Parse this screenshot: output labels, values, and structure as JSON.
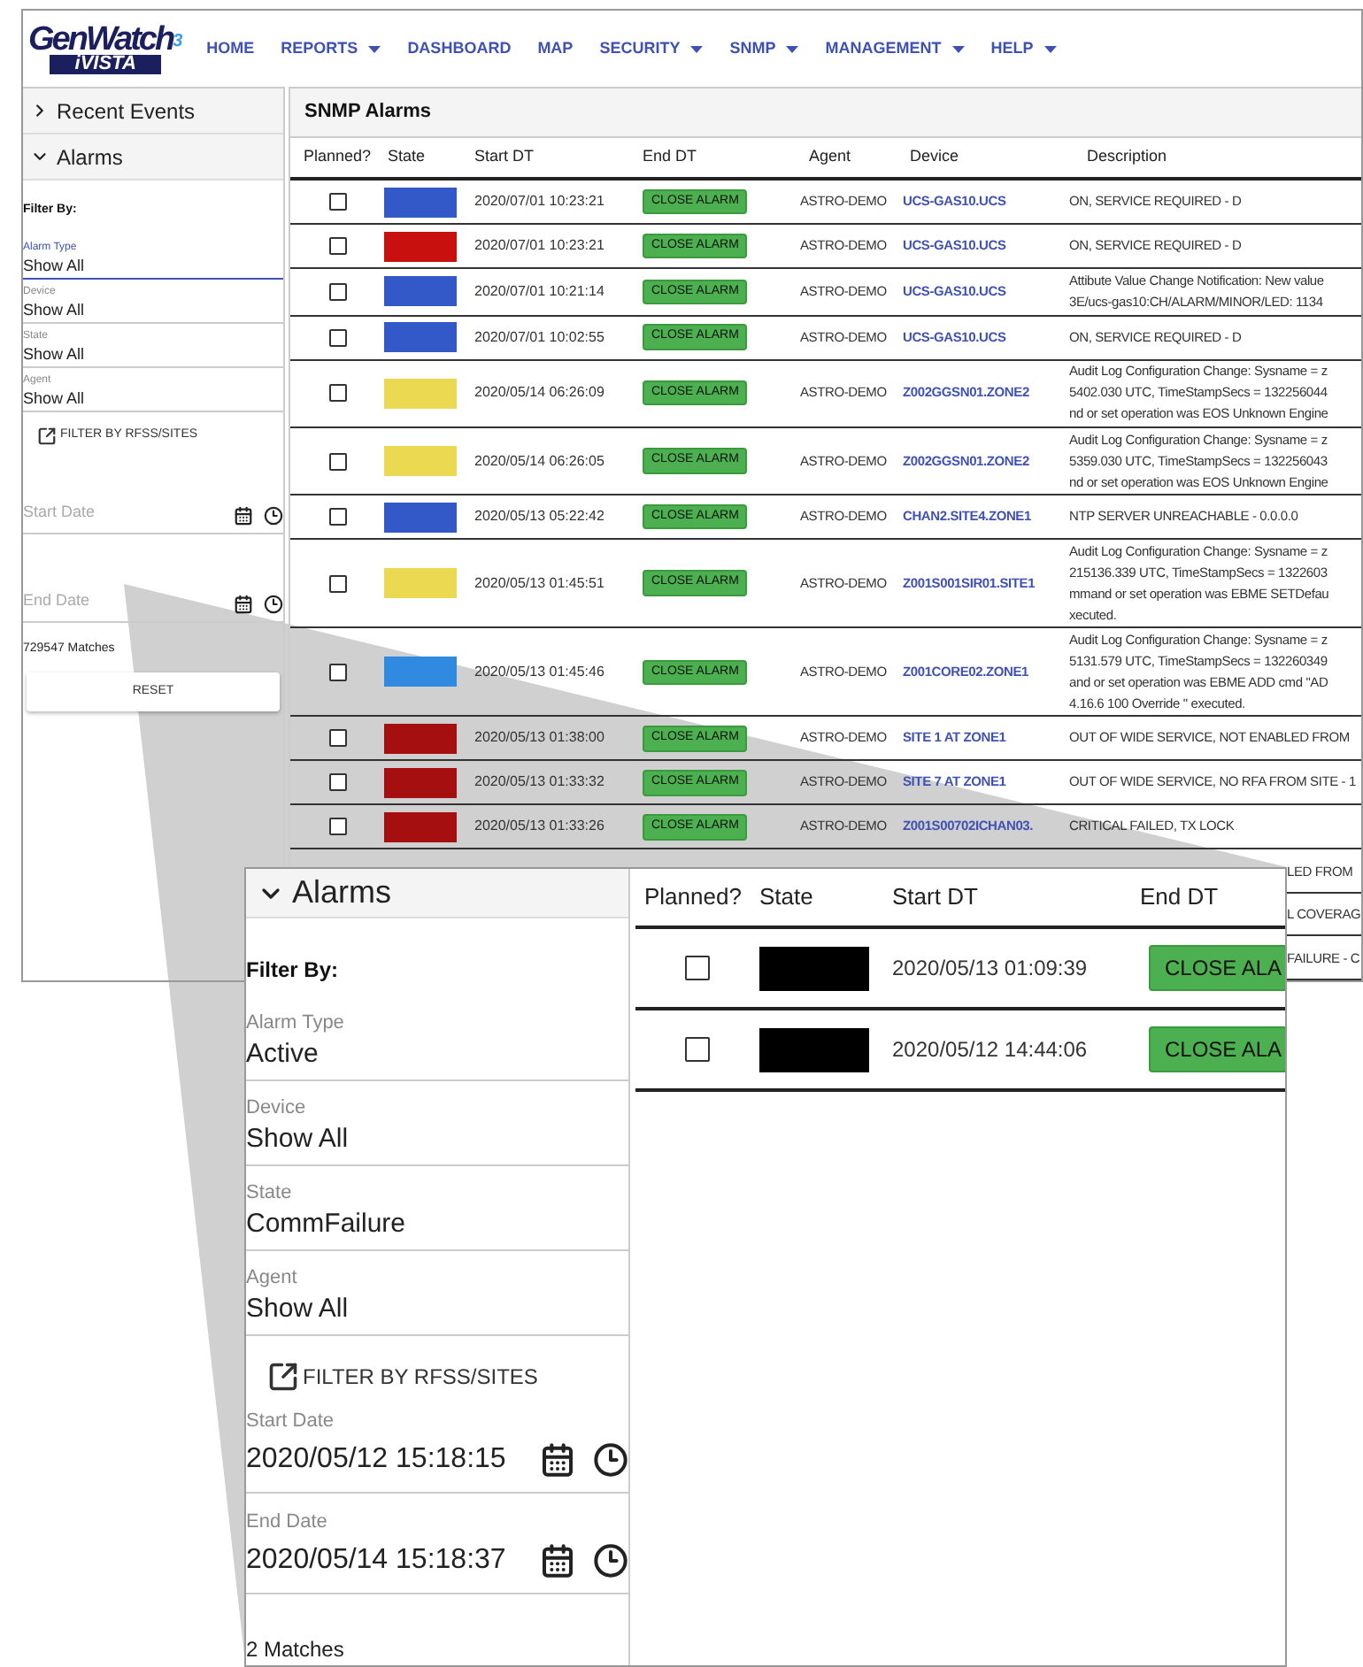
{
  "nav": {
    "logo": {
      "name": "GenWatch",
      "version": "3",
      "edition": "iVISTA"
    },
    "items": [
      {
        "label": "HOME",
        "dropdown": false
      },
      {
        "label": "REPORTS",
        "dropdown": true
      },
      {
        "label": "DASHBOARD",
        "dropdown": false
      },
      {
        "label": "MAP",
        "dropdown": false
      },
      {
        "label": "SECURITY",
        "dropdown": true
      },
      {
        "label": "SNMP",
        "dropdown": true
      },
      {
        "label": "MANAGEMENT",
        "dropdown": true
      },
      {
        "label": "HELP",
        "dropdown": true
      }
    ]
  },
  "sidebar": {
    "sections": [
      {
        "title": "Recent Events",
        "expanded": false
      },
      {
        "title": "Alarms",
        "expanded": true
      }
    ],
    "filter_heading": "Filter By:",
    "fields": [
      {
        "label": "Alarm Type",
        "value": "Show All",
        "focused": true
      },
      {
        "label": "Device",
        "value": "Show All",
        "focused": false
      },
      {
        "label": "State",
        "value": "Show All",
        "focused": false
      },
      {
        "label": "Agent",
        "value": "Show All",
        "focused": false
      }
    ],
    "filter_link": "FILTER BY RFSS/SITES",
    "dates": [
      {
        "placeholder": "Start Date"
      },
      {
        "placeholder": "End Date"
      }
    ],
    "matches": "729547 Matches",
    "reset": "RESET"
  },
  "table": {
    "title": "SNMP Alarms",
    "columns": [
      "Planned?",
      "State",
      "Start DT",
      "End DT",
      "Agent",
      "Device",
      "Description"
    ],
    "rows": [
      {
        "planned": false,
        "color": "#3358c8",
        "start": "2020/07/01 10:23:21",
        "action": "CLOSE ALARM",
        "agent": "ASTRO-DEMO",
        "device": "UCS-GAS10.UCS",
        "description": [
          "ON, SERVICE REQUIRED - D"
        ]
      },
      {
        "planned": false,
        "color": "#c8100f",
        "start": "2020/07/01 10:23:21",
        "action": "CLOSE ALARM",
        "agent": "ASTRO-DEMO",
        "device": "UCS-GAS10.UCS",
        "description": [
          "ON, SERVICE REQUIRED - D"
        ]
      },
      {
        "planned": false,
        "color": "#3358c8",
        "start": "2020/07/01 10:21:14",
        "action": "CLOSE ALARM",
        "agent": "ASTRO-DEMO",
        "device": "UCS-GAS10.UCS",
        "description": [
          "Attibute Value Change Notification: New value",
          "3E/ucs-gas10:CH/ALARM/MINOR/LED: 1134"
        ]
      },
      {
        "planned": false,
        "color": "#3358c8",
        "start": "2020/07/01 10:02:55",
        "action": "CLOSE ALARM",
        "agent": "ASTRO-DEMO",
        "device": "UCS-GAS10.UCS",
        "description": [
          "ON, SERVICE REQUIRED - D"
        ]
      },
      {
        "planned": false,
        "color": "#ebd952",
        "start": "2020/05/14 06:26:09",
        "action": "CLOSE ALARM",
        "agent": "ASTRO-DEMO",
        "device": "Z002GGSN01.ZONE2",
        "description": [
          "Audit Log Configuration Change: Sysname = z",
          "5402.030 UTC, TimeStampSecs = 132256044",
          "nd or set operation was EOS Unknown Engine"
        ]
      },
      {
        "planned": false,
        "color": "#ebd952",
        "start": "2020/05/14 06:26:05",
        "action": "CLOSE ALARM",
        "agent": "ASTRO-DEMO",
        "device": "Z002GGSN01.ZONE2",
        "description": [
          "Audit Log Configuration Change: Sysname = z",
          "5359.030 UTC, TimeStampSecs = 132256043",
          "nd or set operation was EOS Unknown Engine"
        ]
      },
      {
        "planned": false,
        "color": "#3358c8",
        "start": "2020/05/13 05:22:42",
        "action": "CLOSE ALARM",
        "agent": "ASTRO-DEMO",
        "device": "CHAN2.SITE4.ZONE1",
        "description": [
          "NTP SERVER UNREACHABLE - 0.0.0.0"
        ]
      },
      {
        "planned": false,
        "color": "#ebd952",
        "start": "2020/05/13 01:45:51",
        "action": "CLOSE ALARM",
        "agent": "ASTRO-DEMO",
        "device": "Z001S001SIR01.SITE1",
        "description": [
          "Audit Log Configuration Change: Sysname = z",
          "215136.339 UTC, TimeStampSecs = 1322603",
          "mmand or set operation was EBME SETDefau",
          "xecuted."
        ]
      },
      {
        "planned": false,
        "color": "#2f8ae0",
        "start": "2020/05/13 01:45:46",
        "action": "CLOSE ALARM",
        "agent": "ASTRO-DEMO",
        "device": "Z001CORE02.ZONE1",
        "description": [
          "Audit Log Configuration Change: Sysname = z",
          "5131.579 UTC, TimeStampSecs = 132260349",
          "and or set operation was EBME ADD cmd \"AD",
          "4.16.6 100 Override \" executed."
        ]
      },
      {
        "planned": false,
        "color": "#a50f0f",
        "start": "2020/05/13 01:38:00",
        "action": "CLOSE ALARM",
        "agent": "ASTRO-DEMO",
        "device": "SITE 1 AT ZONE1",
        "description": [
          "OUT OF WIDE SERVICE, NOT ENABLED FROM"
        ]
      },
      {
        "planned": false,
        "color": "#a50f0f",
        "start": "2020/05/13 01:33:32",
        "action": "CLOSE ALARM",
        "agent": "ASTRO-DEMO",
        "device": "SITE 7 AT ZONE1",
        "description": [
          "OUT OF WIDE SERVICE, NO RFA FROM SITE - 1"
        ]
      },
      {
        "planned": false,
        "color": "#a50f0f",
        "start": "2020/05/13 01:33:26",
        "action": "CLOSE ALARM",
        "agent": "ASTRO-DEMO",
        "device": "Z001S00702ICHAN03.",
        "description": [
          "CRITICAL FAILED, TX LOCK"
        ]
      }
    ],
    "partial_rows": [
      {
        "description": "LED FROM"
      },
      {
        "description": "L COVERAG"
      },
      {
        "description": "FAILURE - C"
      }
    ]
  },
  "inset": {
    "section": {
      "title": "Alarms",
      "expanded": true
    },
    "filter_heading": "Filter By:",
    "fields": [
      {
        "label": "Alarm Type",
        "value": "Active",
        "focused": false
      },
      {
        "label": "Device",
        "value": "Show All",
        "focused": false
      },
      {
        "label": "State",
        "value": "CommFailure",
        "focused": false
      },
      {
        "label": "Agent",
        "value": "Show All",
        "focused": false
      }
    ],
    "filter_link": "FILTER BY RFSS/SITES",
    "dates": [
      {
        "label": "Start Date",
        "value": "2020/05/12 15:18:15"
      },
      {
        "label": "End Date",
        "value": "2020/05/14 15:18:37"
      }
    ],
    "matches": "2 Matches",
    "columns": [
      "Planned?",
      "State",
      "Start DT",
      "End DT"
    ],
    "rows": [
      {
        "planned": false,
        "color": "#000000",
        "start": "2020/05/13 01:09:39",
        "action": "CLOSE ALA"
      },
      {
        "planned": false,
        "color": "#000000",
        "start": "2020/05/12 14:44:06",
        "action": "CLOSE ALA"
      }
    ]
  }
}
